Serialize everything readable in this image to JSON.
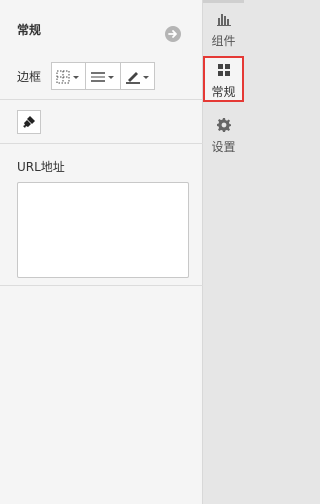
{
  "panel": {
    "title": "常规",
    "border_label": "边框",
    "url_label": "URL地址",
    "url_value": ""
  },
  "sidebar": {
    "items": [
      {
        "label": "组件",
        "icon": "bar-chart-icon"
      },
      {
        "label": "常规",
        "icon": "grid-icon",
        "active": true
      },
      {
        "label": "设置",
        "icon": "gear-icon"
      }
    ]
  },
  "colors": {
    "active_outline": "#e53935"
  }
}
